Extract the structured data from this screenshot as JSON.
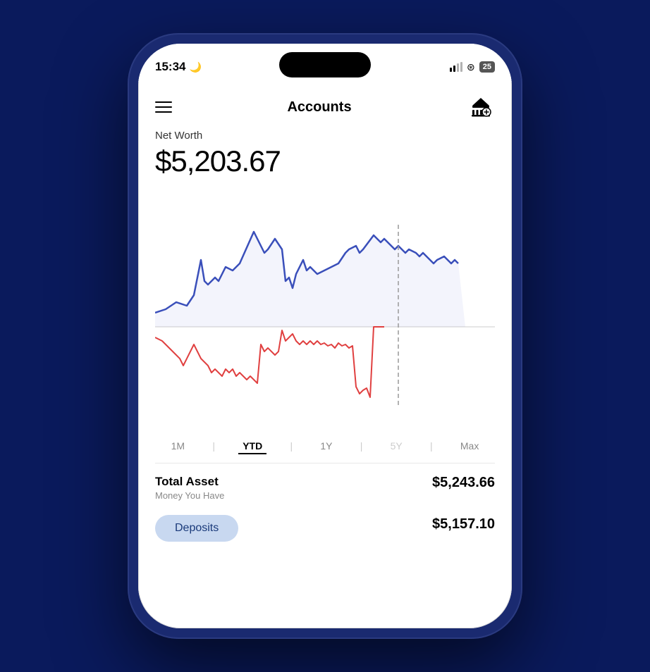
{
  "statusBar": {
    "time": "15:34",
    "moonIcon": "🌙",
    "battery": "25"
  },
  "header": {
    "menuLabel": "menu",
    "title": "Accounts",
    "bankIconLabel": "add bank"
  },
  "netWorth": {
    "label": "Net Worth",
    "value": "$5,203.67"
  },
  "timeFilters": [
    {
      "label": "1M",
      "active": false
    },
    {
      "label": "YTD",
      "active": true
    },
    {
      "label": "1Y",
      "active": false
    },
    {
      "label": "5Y",
      "active": false
    },
    {
      "label": "Max",
      "active": false
    }
  ],
  "bottomSection": {
    "totalAsset": {
      "label": "Total Asset",
      "sublabel": "Money You Have",
      "value": "$5,243.66"
    },
    "depositButton": "Deposits",
    "secondRow": {
      "label": "...",
      "value": "$5,157.10"
    }
  }
}
